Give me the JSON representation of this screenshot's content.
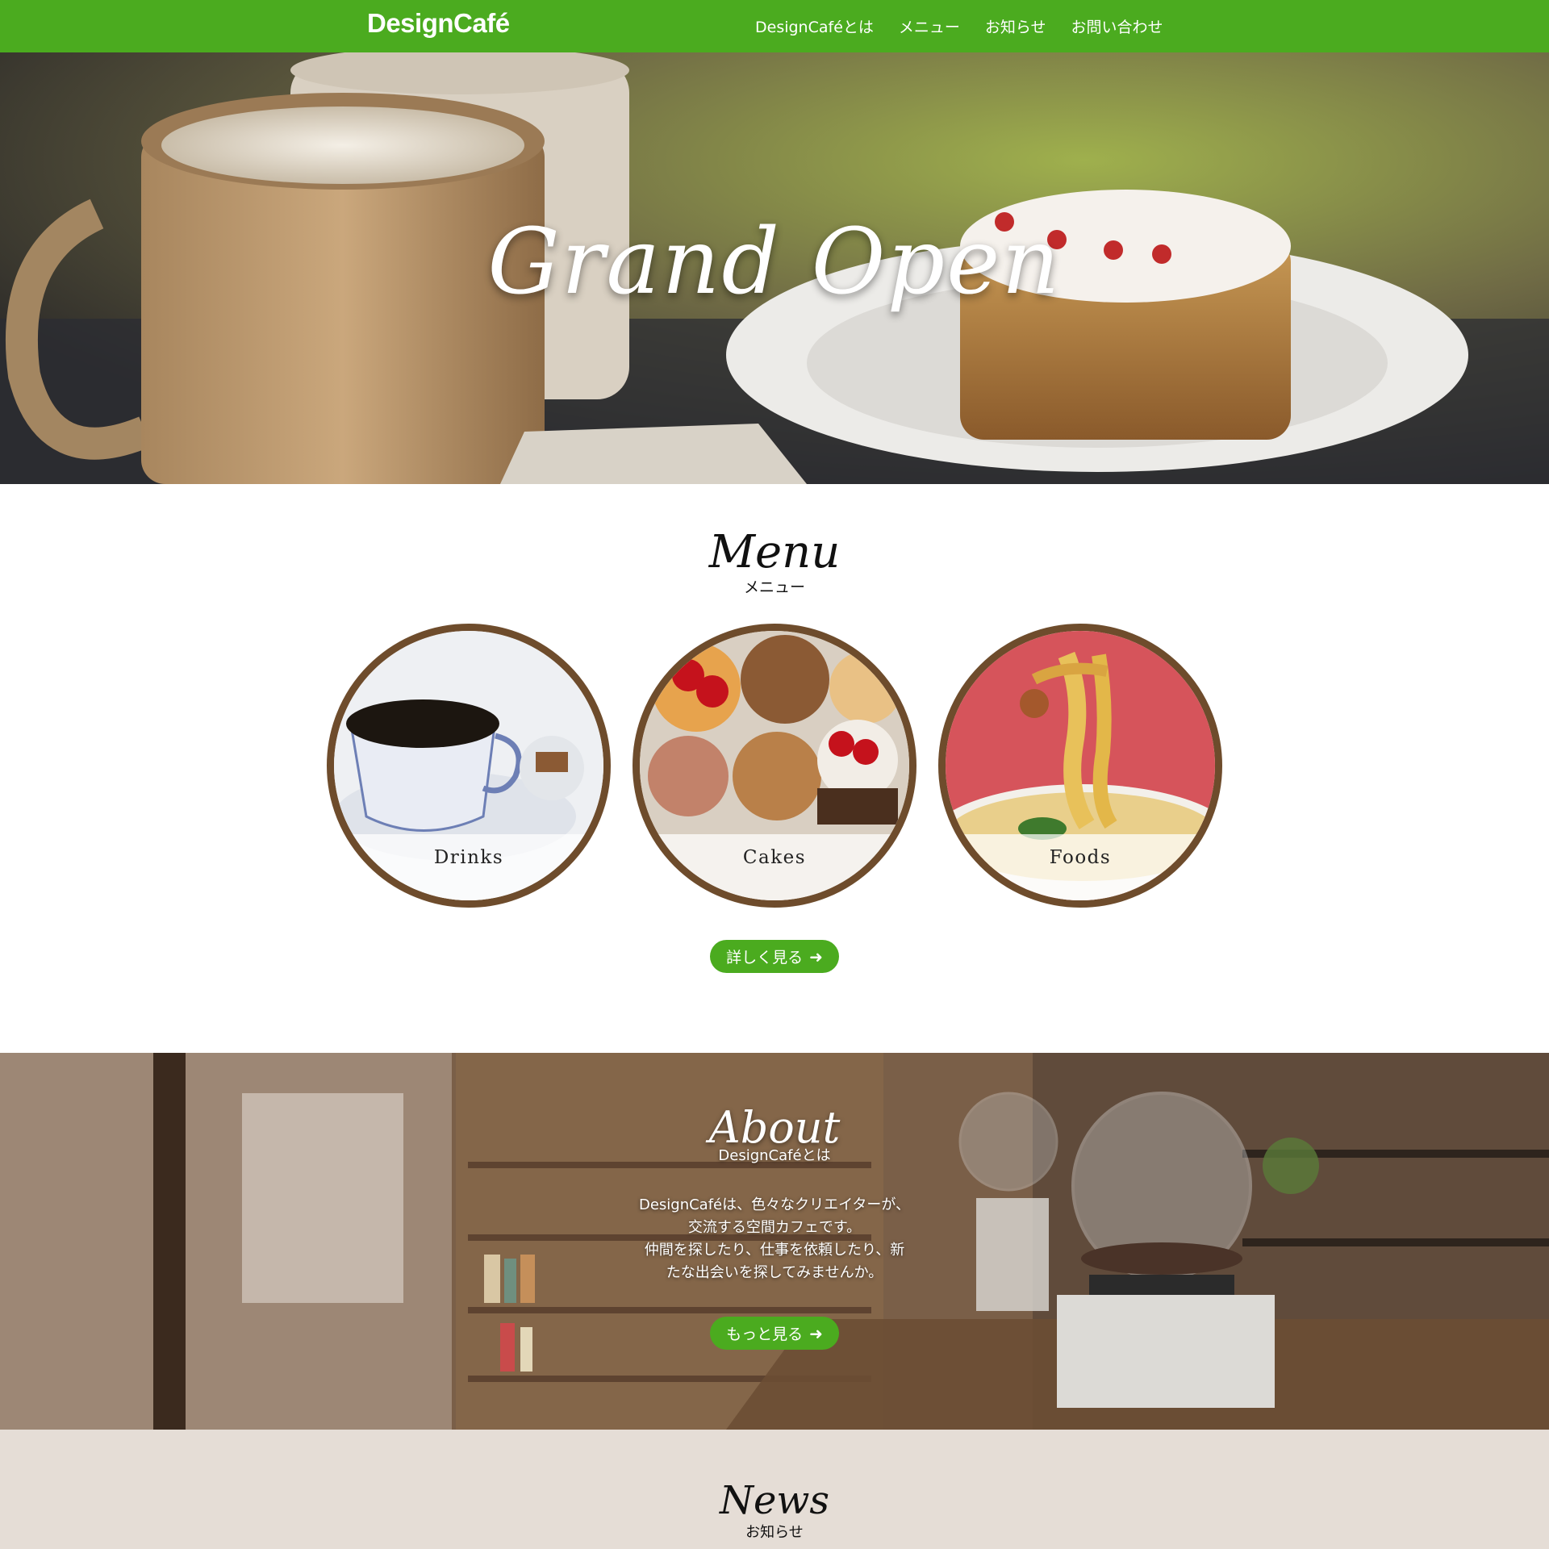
{
  "header": {
    "logo": "DesignCafé",
    "nav": [
      "DesignCaféとは",
      "メニュー",
      "お知らせ",
      "お問い合わせ"
    ]
  },
  "hero": {
    "title": "Grand Open"
  },
  "menu": {
    "title": "Menu",
    "subtitle": "メニュー",
    "items": [
      {
        "label": "Drinks"
      },
      {
        "label": "Cakes"
      },
      {
        "label": "Foods"
      }
    ],
    "button_label": "詳しく見る"
  },
  "about": {
    "title": "About",
    "subtitle": "DesignCaféとは",
    "text_lines": [
      "DesignCaféは、色々なクリエイターが、",
      "交流する空間カフェです。",
      "仲間を探したり、仕事を依頼したり、新",
      "たな出会いを探してみませんか。"
    ],
    "button_label": "もっと見る"
  },
  "news": {
    "title": "News",
    "subtitle": "お知らせ"
  },
  "colors": {
    "brand_green": "#4bab1f",
    "circle_border": "#6e4c2c",
    "news_bg": "#e5ddd6"
  }
}
